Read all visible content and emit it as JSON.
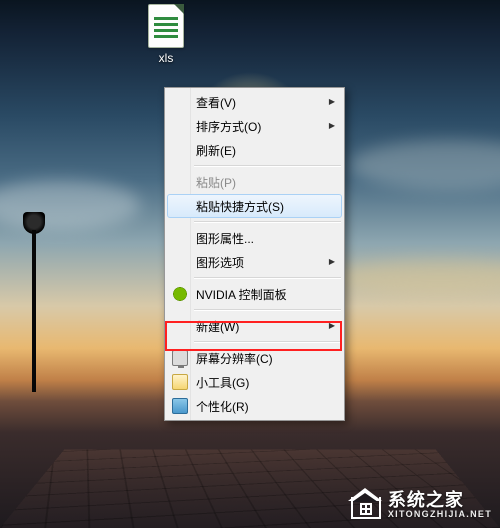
{
  "desktop": {
    "icon_label": "xls"
  },
  "context_menu": {
    "items": [
      {
        "label": "查看(V)",
        "enabled": true,
        "submenu": true,
        "icon": null
      },
      {
        "label": "排序方式(O)",
        "enabled": true,
        "submenu": true,
        "icon": null
      },
      {
        "label": "刷新(E)",
        "enabled": true,
        "submenu": false,
        "icon": null
      },
      {
        "sep": true
      },
      {
        "label": "粘贴(P)",
        "enabled": false,
        "submenu": false,
        "icon": null
      },
      {
        "label": "粘贴快捷方式(S)",
        "enabled": true,
        "submenu": false,
        "icon": null,
        "hover": true
      },
      {
        "sep": true
      },
      {
        "label": "图形属性...",
        "enabled": true,
        "submenu": false,
        "icon": null
      },
      {
        "label": "图形选项",
        "enabled": true,
        "submenu": true,
        "icon": null
      },
      {
        "sep": true
      },
      {
        "label": "NVIDIA 控制面板",
        "enabled": true,
        "submenu": false,
        "icon": "nvidia"
      },
      {
        "sep": true
      },
      {
        "label": "新建(W)",
        "enabled": true,
        "submenu": true,
        "icon": null
      },
      {
        "sep": true
      },
      {
        "label": "屏幕分辨率(C)",
        "enabled": true,
        "submenu": false,
        "icon": "screen"
      },
      {
        "label": "小工具(G)",
        "enabled": true,
        "submenu": false,
        "icon": "gadget",
        "highlight": true
      },
      {
        "label": "个性化(R)",
        "enabled": true,
        "submenu": false,
        "icon": "person"
      }
    ]
  },
  "watermark": {
    "title": "系统之家",
    "url": "XITONGZHIJIA.NET"
  }
}
